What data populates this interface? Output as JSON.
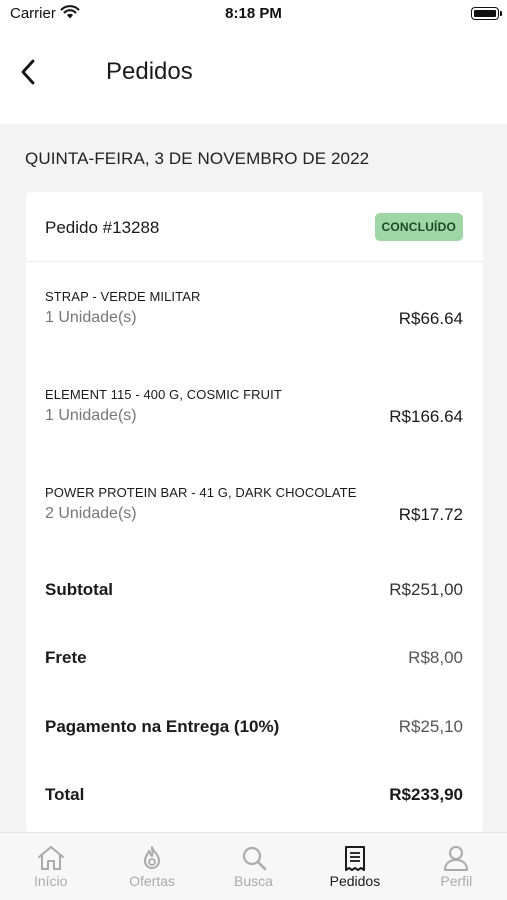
{
  "status_bar": {
    "carrier": "Carrier",
    "time": "8:18 PM"
  },
  "header": {
    "title": "Pedidos"
  },
  "date_heading": "QUINTA-FEIRA, 3 DE NOVEMBRO DE 2022",
  "order": {
    "number": "Pedido #13288",
    "status": "CONCLUÍDO",
    "status_color": "#9fd6a6",
    "items": [
      {
        "name": "STRAP - VERDE MILITAR",
        "quantity": "1 Unidade(s)",
        "price": "R$66.64"
      },
      {
        "name": "ELEMENT 115 - 400 G, COSMIC FRUIT",
        "quantity": "1 Unidade(s)",
        "price": "R$166.64"
      },
      {
        "name": "POWER PROTEIN BAR - 41 G, DARK CHOCOLATE",
        "quantity": "2 Unidade(s)",
        "price": "R$17.72"
      }
    ],
    "summary": {
      "subtotal_label": "Subtotal",
      "subtotal_value": "R$251,00",
      "shipping_label": "Frete",
      "shipping_value": "R$8,00",
      "payment_label": "Pagamento na Entrega (10%)",
      "payment_value": "R$25,10",
      "total_label": "Total",
      "total_value": "R$233,90"
    }
  },
  "tabs": [
    {
      "label": "Início",
      "icon": "home-icon",
      "active": false
    },
    {
      "label": "Ofertas",
      "icon": "flame-icon",
      "active": false
    },
    {
      "label": "Busca",
      "icon": "search-icon",
      "active": false
    },
    {
      "label": "Pedidos",
      "icon": "receipt-icon",
      "active": true
    },
    {
      "label": "Perfil",
      "icon": "user-icon",
      "active": false
    }
  ]
}
